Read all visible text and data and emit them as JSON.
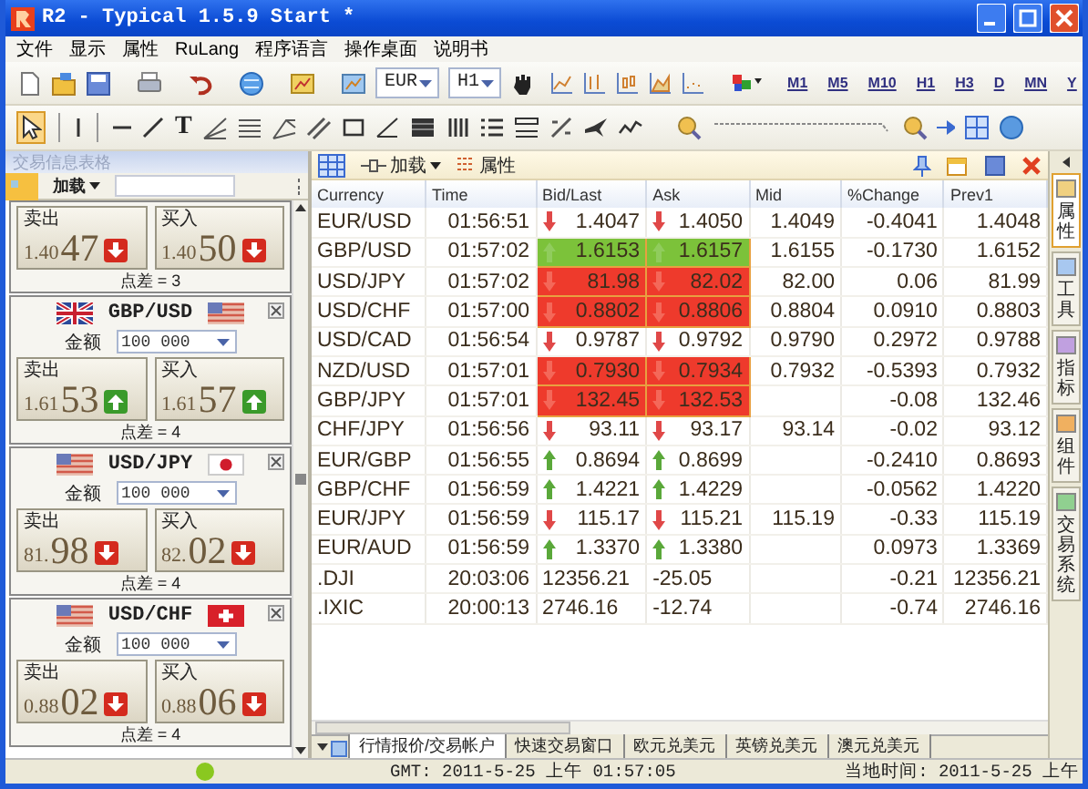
{
  "window": {
    "title": "R2 - Typical 1.5.9 Start *"
  },
  "menu": [
    "文件",
    "显示",
    "属性",
    "RuLang",
    "程序语言",
    "操作桌面",
    "说明书"
  ],
  "toolbar": {
    "symbol": "EUR",
    "period": "H1",
    "timeframes": [
      "M1",
      "M5",
      "M10",
      "H1",
      "H3",
      "D",
      "MN",
      "Y"
    ],
    "text_tool": "T"
  },
  "left_panel": {
    "title": "交易信息表格",
    "load": "加载",
    "cards": [
      {
        "sell": {
          "label": "卖出",
          "prefix": "1.40",
          "pips": "47",
          "up": false
        },
        "buy": {
          "label": "买入",
          "prefix": "1.40",
          "pips": "50",
          "up": false
        },
        "spread": "点差 = 3"
      },
      {
        "pair": "GBP/USD",
        "flags": [
          {
            "kind": "uk"
          },
          {
            "kind": "us"
          }
        ],
        "amount_label": "金额",
        "amount": "100 000",
        "sell": {
          "label": "卖出",
          "prefix": "1.61",
          "pips": "53",
          "up": true
        },
        "buy": {
          "label": "买入",
          "prefix": "1.61",
          "pips": "57",
          "up": true
        },
        "spread": "点差 = 4"
      },
      {
        "pair": "USD/JPY",
        "flags": [
          {
            "kind": "us"
          },
          {
            "kind": "jp"
          }
        ],
        "amount_label": "金额",
        "amount": "100 000",
        "sell": {
          "label": "卖出",
          "prefix": "81.",
          "pips": "98",
          "up": false
        },
        "buy": {
          "label": "买入",
          "prefix": "82.",
          "pips": "02",
          "up": false
        },
        "spread": "点差 = 4"
      },
      {
        "pair": "USD/CHF",
        "flags": [
          {
            "kind": "us"
          },
          {
            "kind": "ch"
          }
        ],
        "amount_label": "金额",
        "amount": "100 000",
        "sell": {
          "label": "卖出",
          "prefix": "0.88",
          "pips": "02",
          "up": false
        },
        "buy": {
          "label": "买入",
          "prefix": "0.88",
          "pips": "06",
          "up": false
        },
        "spread": "点差 = 4"
      }
    ]
  },
  "quotes": {
    "load": "加载",
    "properties": "属性",
    "columns": [
      "Currency",
      "Time",
      "Bid/Last",
      "Ask",
      "Mid",
      "%Change",
      "Prev1"
    ],
    "rows": [
      {
        "currency": "EUR/USD",
        "time": "01:56:51",
        "bid": {
          "value": "1.4047",
          "up": false,
          "flash": false
        },
        "ask": {
          "value": "1.4050",
          "up": false,
          "flash": false
        },
        "mid": "1.4049",
        "change": "-0.4041",
        "prev": "1.4048"
      },
      {
        "currency": "GBP/USD",
        "time": "01:57:02",
        "bid": {
          "value": "1.6153",
          "up": true,
          "flash": true
        },
        "ask": {
          "value": "1.6157",
          "up": true,
          "flash": true
        },
        "mid": "1.6155",
        "change": "-0.1730",
        "prev": "1.6152"
      },
      {
        "currency": "USD/JPY",
        "time": "01:57:02",
        "bid": {
          "value": "81.98",
          "up": false,
          "flash": true
        },
        "ask": {
          "value": "82.02",
          "up": false,
          "flash": true
        },
        "mid": "82.00",
        "change": "0.06",
        "prev": "81.99"
      },
      {
        "currency": "USD/CHF",
        "time": "01:57:00",
        "bid": {
          "value": "0.8802",
          "up": false,
          "flash": true
        },
        "ask": {
          "value": "0.8806",
          "up": false,
          "flash": true
        },
        "mid": "0.8804",
        "change": "0.0910",
        "prev": "0.8803"
      },
      {
        "currency": "USD/CAD",
        "time": "01:56:54",
        "bid": {
          "value": "0.9787",
          "up": false,
          "flash": false
        },
        "ask": {
          "value": "0.9792",
          "up": false,
          "flash": false
        },
        "mid": "0.9790",
        "change": "0.2972",
        "prev": "0.9788"
      },
      {
        "currency": "NZD/USD",
        "time": "01:57:01",
        "bid": {
          "value": "0.7930",
          "up": false,
          "flash": true
        },
        "ask": {
          "value": "0.7934",
          "up": false,
          "flash": true
        },
        "mid": "0.7932",
        "change": "-0.5393",
        "prev": "0.7932"
      },
      {
        "currency": "GBP/JPY",
        "time": "01:57:01",
        "bid": {
          "value": "132.45",
          "up": false,
          "flash": true
        },
        "ask": {
          "value": "132.53",
          "up": false,
          "flash": true
        },
        "change": "-0.08",
        "prev": "132.46"
      },
      {
        "currency": "CHF/JPY",
        "time": "01:56:56",
        "bid": {
          "value": "93.11",
          "up": false,
          "flash": false
        },
        "ask": {
          "value": "93.17",
          "up": false,
          "flash": false
        },
        "mid": "93.14",
        "change": "-0.02",
        "prev": "93.12"
      },
      {
        "currency": "EUR/GBP",
        "time": "01:56:55",
        "bid": {
          "value": "0.8694",
          "up": true,
          "flash": false
        },
        "ask": {
          "value": "0.8699",
          "up": true,
          "flash": false
        },
        "change": "-0.2410",
        "prev": "0.8693"
      },
      {
        "currency": "GBP/CHF",
        "time": "01:56:59",
        "bid": {
          "value": "1.4221",
          "up": true,
          "flash": false
        },
        "ask": {
          "value": "1.4229",
          "up": true,
          "flash": false
        },
        "change": "-0.0562",
        "prev": "1.4220"
      },
      {
        "currency": "EUR/JPY",
        "time": "01:56:59",
        "bid": {
          "value": "115.17",
          "up": false,
          "flash": false
        },
        "ask": {
          "value": "115.21",
          "up": false,
          "flash": false
        },
        "mid": "115.19",
        "change": "-0.33",
        "prev": "115.19"
      },
      {
        "currency": "EUR/AUD",
        "time": "01:56:59",
        "bid": {
          "value": "1.3370",
          "up": true,
          "flash": false
        },
        "ask": {
          "value": "1.3380",
          "up": true,
          "flash": false
        },
        "change": "0.0973",
        "prev": "1.3369"
      },
      {
        "currency": ".DJI",
        "time": "20:03:06",
        "bid": {
          "value": "12356.21"
        },
        "ask": {
          "value": "-25.05"
        },
        "change": "-0.21",
        "prev": "12356.21"
      },
      {
        "currency": ".IXIC",
        "time": "20:00:13",
        "bid": {
          "value": "2746.16"
        },
        "ask": {
          "value": "-12.74"
        },
        "change": "-0.74",
        "prev": "2746.16"
      }
    ]
  },
  "side_tabs": [
    {
      "label": "属性",
      "selected": true
    },
    {
      "label": "工具",
      "selected": false
    },
    {
      "label": "指标",
      "selected": false
    },
    {
      "label": "组件",
      "selected": false
    },
    {
      "label": "交易系统",
      "selected": false
    }
  ],
  "bottom_tabs": [
    {
      "label": "行情报价/交易帐户",
      "selected": true
    },
    {
      "label": "快速交易窗口",
      "selected": false
    },
    {
      "label": "欧元兑美元",
      "selected": false
    },
    {
      "label": "英镑兑美元",
      "selected": false
    },
    {
      "label": "澳元兑美元",
      "selected": false
    }
  ],
  "status_bar": {
    "gmt_label": "GMT:",
    "gmt": "2011-5-25 上午 01:57:05",
    "local_label": "当地时间:",
    "local": "2011-5-25 上午"
  }
}
